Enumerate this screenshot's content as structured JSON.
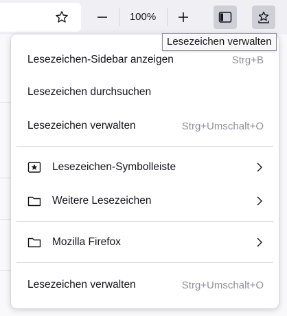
{
  "toolbar": {
    "star_icon": "star-outline-icon",
    "zoom_out_icon": "minus-icon",
    "zoom_level": "100%",
    "zoom_in_icon": "plus-icon",
    "sidebar_icon": "sidebar-icon",
    "bookmarks_menu_icon": "bookmarks-star-tray-icon"
  },
  "tooltip": {
    "text": "Lesezeichen verwalten"
  },
  "bookmarks_menu": {
    "items": [
      {
        "label": "Lesezeichen-Sidebar anzeigen",
        "shortcut": "Strg+B"
      },
      {
        "label": "Lesezeichen durchsuchen",
        "shortcut": ""
      },
      {
        "label": "Lesezeichen verwalten",
        "shortcut": "Strg+Umschalt+O"
      }
    ],
    "folders": [
      {
        "label": "Lesezeichen-Symbolleiste",
        "icon": "bookmarks-toolbar-icon"
      },
      {
        "label": "Weitere Lesezeichen",
        "icon": "folder-icon"
      }
    ],
    "recent_folders": [
      {
        "label": "Mozilla Firefox",
        "icon": "folder-icon"
      }
    ],
    "footer": {
      "label": "Lesezeichen verwalten",
      "shortcut": "Strg+Umschalt+O"
    }
  },
  "colors": {
    "toolbar_bg": "#f0f0f4",
    "active_button_bg": "#cfcfd8",
    "shortcut_text": "#8f8f9d",
    "separator": "#d7d7db"
  }
}
